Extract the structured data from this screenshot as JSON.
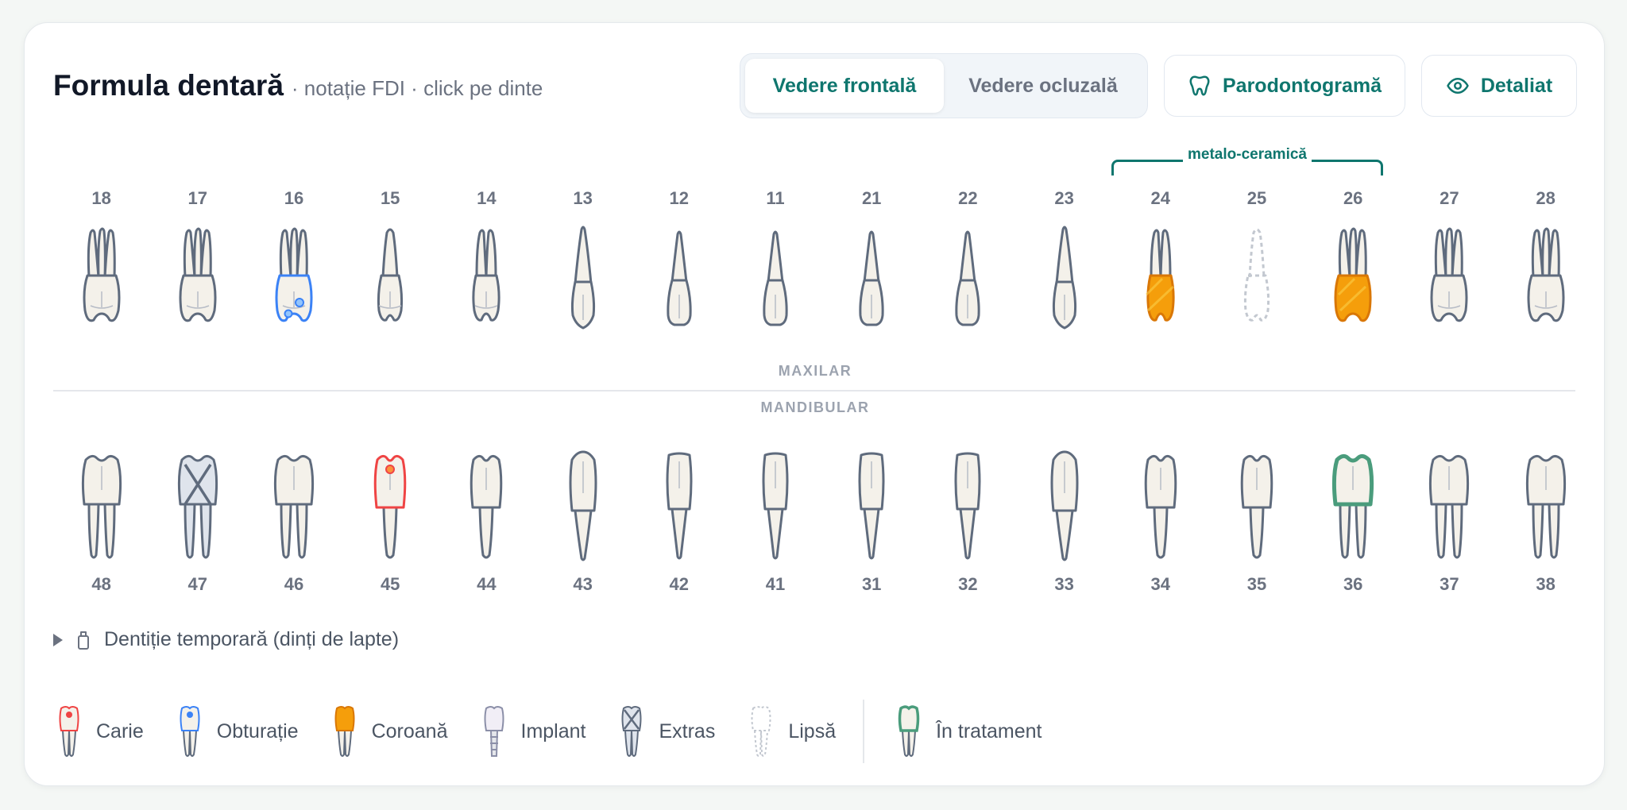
{
  "header": {
    "title": "Formula dentară",
    "subtitle": "· notație FDI · click pe dinte"
  },
  "view_toggle": {
    "frontal_label": "Vedere frontală",
    "occlusal_label": "Vedere ocluzală",
    "active": "frontal"
  },
  "buttons": {
    "perio_label": "Parodontogramă",
    "perio_icon": "tooth-icon",
    "detail_label": "Detaliat",
    "detail_icon": "eye-icon"
  },
  "bridge": {
    "label": "metalo-ceramică",
    "from": "24",
    "to": "26"
  },
  "arches": {
    "upper_label": "MAXILAR",
    "lower_label": "MANDIBULAR"
  },
  "upper_teeth": [
    {
      "num": "18",
      "type": "molar",
      "status": "healthy"
    },
    {
      "num": "17",
      "type": "molar",
      "status": "healthy"
    },
    {
      "num": "16",
      "type": "molar",
      "status": "filling"
    },
    {
      "num": "15",
      "type": "premolar1",
      "status": "healthy"
    },
    {
      "num": "14",
      "type": "premolar2",
      "status": "healthy"
    },
    {
      "num": "13",
      "type": "canine",
      "status": "healthy"
    },
    {
      "num": "12",
      "type": "incisor",
      "status": "healthy"
    },
    {
      "num": "11",
      "type": "incisor",
      "status": "healthy"
    },
    {
      "num": "21",
      "type": "incisor",
      "status": "healthy"
    },
    {
      "num": "22",
      "type": "incisor",
      "status": "healthy"
    },
    {
      "num": "23",
      "type": "canine",
      "status": "healthy"
    },
    {
      "num": "24",
      "type": "premolar2",
      "status": "crown"
    },
    {
      "num": "25",
      "type": "premolar1",
      "status": "missing"
    },
    {
      "num": "26",
      "type": "molar",
      "status": "crown"
    },
    {
      "num": "27",
      "type": "molar",
      "status": "healthy"
    },
    {
      "num": "28",
      "type": "molar",
      "status": "healthy"
    }
  ],
  "lower_teeth": [
    {
      "num": "48",
      "type": "molar",
      "status": "healthy"
    },
    {
      "num": "47",
      "type": "molar",
      "status": "extracted"
    },
    {
      "num": "46",
      "type": "molar",
      "status": "healthy"
    },
    {
      "num": "45",
      "type": "premolar",
      "status": "caries"
    },
    {
      "num": "44",
      "type": "premolar",
      "status": "healthy"
    },
    {
      "num": "43",
      "type": "canine",
      "status": "healthy"
    },
    {
      "num": "42",
      "type": "incisor",
      "status": "healthy"
    },
    {
      "num": "41",
      "type": "incisor",
      "status": "healthy"
    },
    {
      "num": "31",
      "type": "incisor",
      "status": "healthy"
    },
    {
      "num": "32",
      "type": "incisor",
      "status": "healthy"
    },
    {
      "num": "33",
      "type": "canine",
      "status": "healthy"
    },
    {
      "num": "34",
      "type": "premolar",
      "status": "healthy"
    },
    {
      "num": "35",
      "type": "premolar",
      "status": "healthy"
    },
    {
      "num": "36",
      "type": "molar",
      "status": "treatment"
    },
    {
      "num": "37",
      "type": "molar",
      "status": "healthy"
    },
    {
      "num": "38",
      "type": "molar",
      "status": "healthy"
    }
  ],
  "temporary": {
    "label": "Dentiție temporară (dinți de lapte)",
    "expanded": false,
    "icon": "baby-tooth-icon"
  },
  "legend": [
    {
      "key": "caries",
      "label": "Carie"
    },
    {
      "key": "filling",
      "label": "Obturație"
    },
    {
      "key": "crown",
      "label": "Coroană"
    },
    {
      "key": "implant",
      "label": "Implant"
    },
    {
      "key": "extracted",
      "label": "Extras"
    },
    {
      "key": "missing",
      "label": "Lipsă"
    },
    {
      "key": "treatment",
      "label": "În tratament"
    }
  ],
  "colors": {
    "accent": "#0f766e",
    "caries": "#ef4444",
    "filling": "#3b82f6",
    "crown": "#f59e0b",
    "treatment": "#4a9c7c",
    "outline": "#5f6b7d",
    "enamel": "#f4f1ea",
    "missing": "#c3c8d0"
  }
}
